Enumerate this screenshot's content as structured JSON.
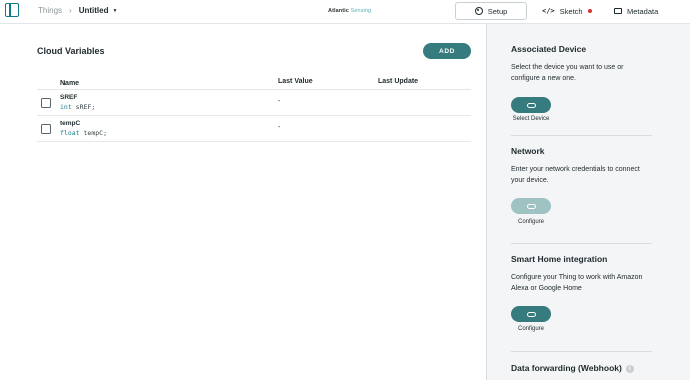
{
  "breadcrumb": {
    "root": "Things",
    "separator": "›",
    "current": "Untitled"
  },
  "brand": {
    "name": "Atlantic",
    "sub": "Sensing"
  },
  "tabs": [
    {
      "label": "Setup",
      "icon": "gear-icon",
      "active": true
    },
    {
      "label": "Sketch",
      "icon": "code-icon",
      "status": "unsaved-red-dot"
    },
    {
      "label": "Metadata",
      "icon": "tag-icon"
    }
  ],
  "cloud_variables": {
    "title": "Cloud Variables",
    "add_label": "ADD",
    "columns": {
      "name": "Name",
      "sort_glyph": "↓",
      "last_value": "Last Value",
      "last_update": "Last Update"
    },
    "rows": [
      {
        "name": "SREF",
        "type": "int",
        "decl": "sREF;",
        "last_value": "-",
        "last_update": ""
      },
      {
        "name": "tempC",
        "type": "float",
        "decl": "tempC;",
        "last_value": "-",
        "last_update": ""
      }
    ]
  },
  "associated_device": {
    "title": "Associated Device",
    "description": "Select the device you want to use or configure a new one.",
    "button_caption": "Select Device"
  },
  "network": {
    "title": "Network",
    "description": "Enter your network credentials to connect your device.",
    "button_caption": "Configure"
  },
  "smart_home": {
    "title": "Smart Home integration",
    "description": "Configure your Thing to work with Amazon Alexa or Google Home",
    "button_caption": "Configure"
  },
  "data_forwarding": {
    "title": "Data forwarding (Webhook)",
    "info_glyph": "i"
  },
  "colors": {
    "accent": "#367b7d",
    "accent_disabled": "#9fc2c3",
    "unsaved_dot": "#d8322f"
  }
}
